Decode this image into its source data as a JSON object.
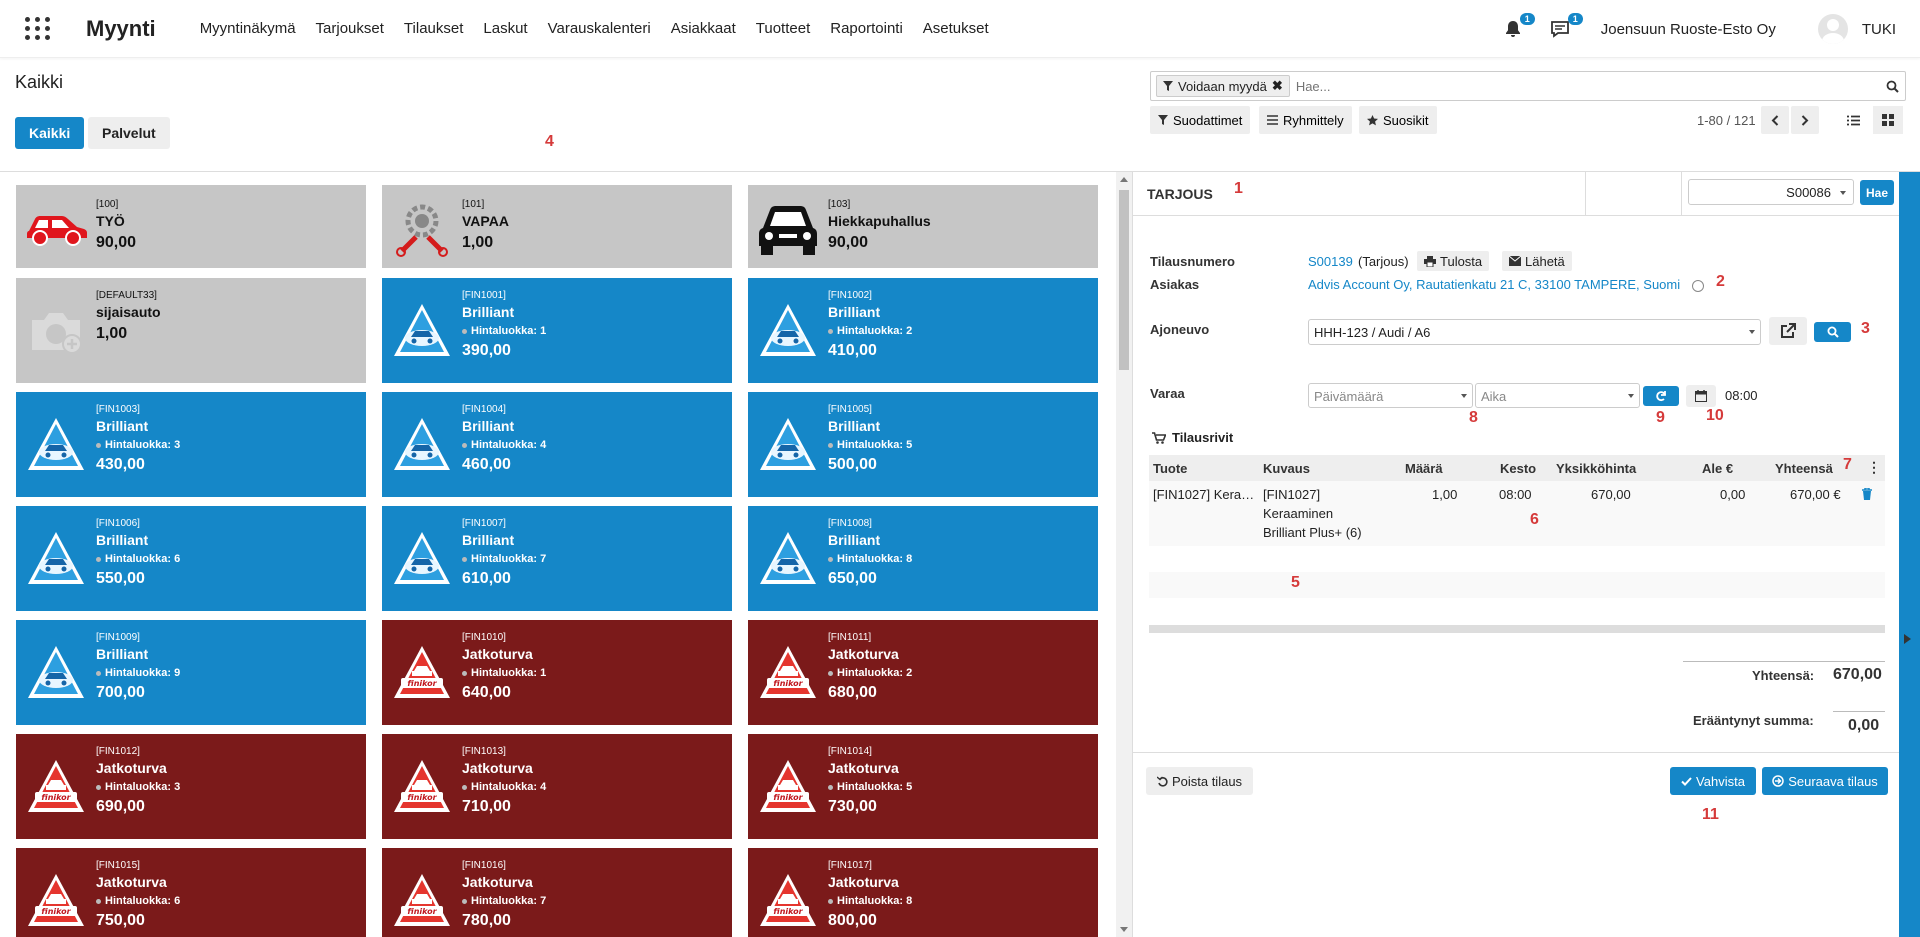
{
  "app": {
    "name": "Myynti"
  },
  "menu": [
    "Myyntinäkymä",
    "Tarjoukset",
    "Tilaukset",
    "Laskut",
    "Varauskalenteri",
    "Asiakkaat",
    "Tuotteet",
    "Raportointi",
    "Asetukset"
  ],
  "topbar": {
    "notif_count": "1",
    "msg_count": "1",
    "company": "Joensuun Ruoste-Esto Oy",
    "user": "TUKI"
  },
  "controls": {
    "breadcrumb": "Kaikki",
    "tab_all": "Kaikki",
    "tab_services": "Palvelut",
    "facet": "Voidaan myydä",
    "search_placeholder": "Hae...",
    "filters": "Suodattimet",
    "group": "Ryhmittely",
    "favorites": "Suosikit",
    "pager": "1-80 / 121"
  },
  "products": [
    {
      "code": "[100]",
      "name": "TYÖ",
      "cls": "",
      "price": "90,00",
      "style": "gray",
      "icon": "car-icon"
    },
    {
      "code": "[101]",
      "name": "VAPAA",
      "cls": "",
      "price": "1,00",
      "style": "gray",
      "icon": "tools-icon"
    },
    {
      "code": "[103]",
      "name": "Hiekkapuhallus",
      "cls": "",
      "price": "90,00",
      "style": "gray",
      "icon": "car-front-icon"
    },
    {
      "code": "[DEFAULT33]",
      "name": "sijaisauto",
      "cls": "",
      "price": "1,00",
      "style": "gray",
      "icon": "camera-icon"
    },
    {
      "code": "[FIN1001]",
      "name": "Brilliant",
      "cls": "Hintaluokka: 1",
      "price": "390,00",
      "style": "blue",
      "icon": "brilliant-logo-icon"
    },
    {
      "code": "[FIN1002]",
      "name": "Brilliant",
      "cls": "Hintaluokka: 2",
      "price": "410,00",
      "style": "blue",
      "icon": "brilliant-logo-icon"
    },
    {
      "code": "[FIN1003]",
      "name": "Brilliant",
      "cls": "Hintaluokka: 3",
      "price": "430,00",
      "style": "blue",
      "icon": "brilliant-logo-icon"
    },
    {
      "code": "[FIN1004]",
      "name": "Brilliant",
      "cls": "Hintaluokka: 4",
      "price": "460,00",
      "style": "blue",
      "icon": "brilliant-logo-icon"
    },
    {
      "code": "[FIN1005]",
      "name": "Brilliant",
      "cls": "Hintaluokka: 5",
      "price": "500,00",
      "style": "blue",
      "icon": "brilliant-logo-icon"
    },
    {
      "code": "[FIN1006]",
      "name": "Brilliant",
      "cls": "Hintaluokka: 6",
      "price": "550,00",
      "style": "blue",
      "icon": "brilliant-logo-icon"
    },
    {
      "code": "[FIN1007]",
      "name": "Brilliant",
      "cls": "Hintaluokka: 7",
      "price": "610,00",
      "style": "blue",
      "icon": "brilliant-logo-icon"
    },
    {
      "code": "[FIN1008]",
      "name": "Brilliant",
      "cls": "Hintaluokka: 8",
      "price": "650,00",
      "style": "blue",
      "icon": "brilliant-logo-icon"
    },
    {
      "code": "[FIN1009]",
      "name": "Brilliant",
      "cls": "Hintaluokka: 9",
      "price": "700,00",
      "style": "blue",
      "icon": "brilliant-logo-icon"
    },
    {
      "code": "[FIN1010]",
      "name": "Jatkoturva",
      "cls": "Hintaluokka: 1",
      "price": "640,00",
      "style": "red",
      "icon": "finikor-logo-icon"
    },
    {
      "code": "[FIN1011]",
      "name": "Jatkoturva",
      "cls": "Hintaluokka: 2",
      "price": "680,00",
      "style": "red",
      "icon": "finikor-logo-icon"
    },
    {
      "code": "[FIN1012]",
      "name": "Jatkoturva",
      "cls": "Hintaluokka: 3",
      "price": "690,00",
      "style": "red",
      "icon": "finikor-logo-icon"
    },
    {
      "code": "[FIN1013]",
      "name": "Jatkoturva",
      "cls": "Hintaluokka: 4",
      "price": "710,00",
      "style": "red",
      "icon": "finikor-logo-icon"
    },
    {
      "code": "[FIN1014]",
      "name": "Jatkoturva",
      "cls": "Hintaluokka: 5",
      "price": "730,00",
      "style": "red",
      "icon": "finikor-logo-icon"
    },
    {
      "code": "[FIN1015]",
      "name": "Jatkoturva",
      "cls": "Hintaluokka: 6",
      "price": "750,00",
      "style": "red",
      "icon": "finikor-logo-icon"
    },
    {
      "code": "[FIN1016]",
      "name": "Jatkoturva",
      "cls": "Hintaluokka: 7",
      "price": "780,00",
      "style": "red",
      "icon": "finikor-logo-icon"
    },
    {
      "code": "[FIN1017]",
      "name": "Jatkoturva",
      "cls": "Hintaluokka: 8",
      "price": "800,00",
      "style": "red",
      "icon": "finikor-logo-icon"
    }
  ],
  "panel": {
    "title": "TARJOUS",
    "order_select": "S00086",
    "hae": "Hae",
    "order_label": "Tilausnumero",
    "order_link": "S00139",
    "order_state": "(Tarjous)",
    "print": "Tulosta",
    "send": "Lähetä",
    "customer_label": "Asiakas",
    "customer": "Advis Account Oy, Rautatienkatu 21 C, 33100 TAMPERE, Suomi",
    "vehicle_label": "Ajoneuvo",
    "vehicle": "HHH-123 / Audi / A6",
    "book_label": "Varaa",
    "date_placeholder": "Päivämäärä",
    "time_placeholder": "Aika",
    "time_value": "08:00",
    "lines_title": "Tilausrivit",
    "columns": [
      "Tuote",
      "Kuvaus",
      "Määrä",
      "Kesto",
      "Yksikköhinta",
      "Ale €",
      "Yhteensä"
    ],
    "line": {
      "product": "[FIN1027] Kera…",
      "desc1": "[FIN1027]",
      "desc2": "Keraaminen",
      "desc3": "Brilliant Plus+ (6)",
      "qty": "1,00",
      "duration": "08:00",
      "unit_price": "670,00",
      "discount": "0,00",
      "total": "670,00 €"
    },
    "total_label": "Yhteensä:",
    "total_value": "670,00",
    "overdue_label": "Erääntynyt summa:",
    "overdue_value": "0,00",
    "delete_order": "Poista tilaus",
    "confirm": "Vahvista",
    "next_order": "Seuraava tilaus"
  },
  "annotations": [
    "1",
    "2",
    "3",
    "4",
    "5",
    "6",
    "7",
    "8",
    "9",
    "10",
    "11"
  ]
}
